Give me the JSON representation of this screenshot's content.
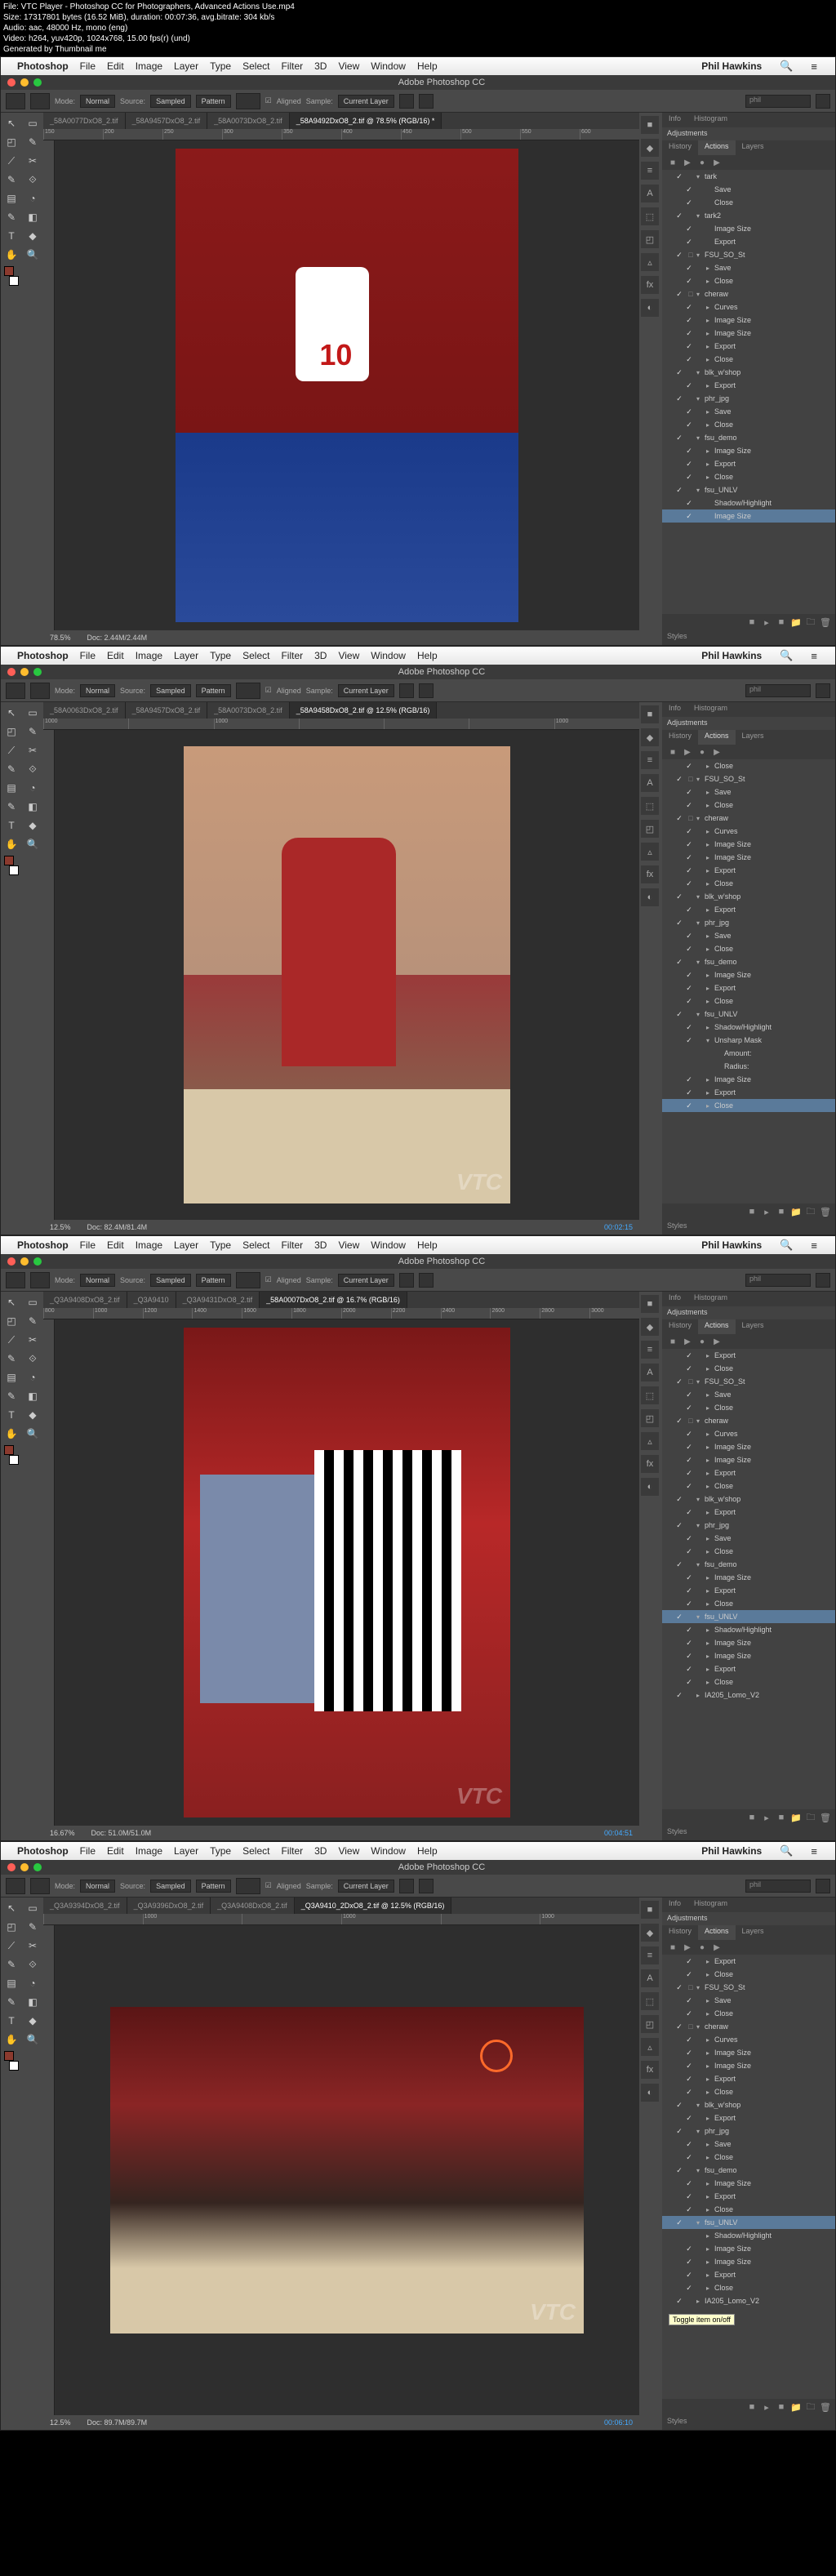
{
  "file_info": {
    "l1": "File: VTC Player - Photoshop CC for Photographers, Advanced Actions Use.mp4",
    "l2": "Size: 17317801 bytes (16.52 MiB), duration: 00:07:36, avg.bitrate: 304 kb/s",
    "l3": "Audio: aac, 48000 Hz, mono (eng)",
    "l4": "Video: h264, yuv420p, 1024x768, 15.00 fps(r) (und)",
    "l5": "Generated by Thumbnail me"
  },
  "menu": {
    "app": "Photoshop",
    "items": [
      "File",
      "Edit",
      "Image",
      "Layer",
      "Type",
      "Select",
      "Filter",
      "3D",
      "View",
      "Window",
      "Help"
    ],
    "user": "Phil Hawkins"
  },
  "title": "Adobe Photoshop CC",
  "options": {
    "mode": "Mode:",
    "mode_v": "Normal",
    "source": "Source:",
    "sampled": "Sampled",
    "pattern": "Pattern",
    "aligned": "Aligned",
    "sample": "Sample:",
    "sample_v": "Current Layer",
    "search": "phil"
  },
  "tools": [
    "↖",
    "▭",
    "◰",
    "✎",
    "⟋",
    "✂",
    "✎",
    "⟐",
    "▤",
    "◔",
    "✎",
    "◧",
    "T",
    "◆",
    "✋",
    "🔍"
  ],
  "panel_icons": [
    "■",
    "◆",
    "≡",
    "A",
    "⬚",
    "◰",
    "▵",
    "fx",
    "◐"
  ],
  "panel_tabs": {
    "info": "Info",
    "histogram": "Histogram",
    "adjustments": "Adjustments",
    "history": "History",
    "actions": "Actions",
    "layers": "Layers",
    "styles": "Styles"
  },
  "action_ctrl": [
    "■",
    "▶",
    "●",
    "▶"
  ],
  "footer_icons": [
    "■",
    "▸",
    "■",
    "📁",
    "🗀",
    "🗑"
  ],
  "windows": [
    {
      "tabs": [
        "_58A0077DxO8_2.tif",
        "_58A9457DxO8_2.tif",
        "_58A0073DxO8_2.tif"
      ],
      "active_tab": "_58A9492DxO8_2.tif @ 78.5% (RGB/16) *",
      "ruler": [
        "150",
        "200",
        "250",
        "300",
        "350",
        "400",
        "450",
        "500",
        "550",
        "600"
      ],
      "zoom": "78.5%",
      "doc": "Doc: 2.44M/2.44M",
      "time": "",
      "photo": "p1",
      "jersey_num": "10",
      "actions": [
        {
          "d": 1,
          "a": "▾",
          "t": "tark",
          "chk": "✓",
          "dlg": ""
        },
        {
          "d": 2,
          "a": "",
          "t": "Save",
          "chk": "✓",
          "dlg": ""
        },
        {
          "d": 2,
          "a": "",
          "t": "Close",
          "chk": "✓",
          "dlg": ""
        },
        {
          "d": 1,
          "a": "▾",
          "t": "tark2",
          "chk": "✓",
          "dlg": ""
        },
        {
          "d": 2,
          "a": "",
          "t": "Image Size",
          "chk": "✓",
          "dlg": ""
        },
        {
          "d": 2,
          "a": "",
          "t": "Export",
          "chk": "✓",
          "dlg": ""
        },
        {
          "d": 1,
          "a": "▾",
          "t": "FSU_SO_St",
          "chk": "✓",
          "dlg": "□"
        },
        {
          "d": 2,
          "a": "▸",
          "t": "Save",
          "chk": "✓",
          "dlg": ""
        },
        {
          "d": 2,
          "a": "▸",
          "t": "Close",
          "chk": "✓",
          "dlg": ""
        },
        {
          "d": 1,
          "a": "▾",
          "t": "cheraw",
          "chk": "✓",
          "dlg": "□"
        },
        {
          "d": 2,
          "a": "▸",
          "t": "Curves",
          "chk": "✓",
          "dlg": ""
        },
        {
          "d": 2,
          "a": "▸",
          "t": "Image Size",
          "chk": "✓",
          "dlg": ""
        },
        {
          "d": 2,
          "a": "▸",
          "t": "Image Size",
          "chk": "✓",
          "dlg": ""
        },
        {
          "d": 2,
          "a": "▸",
          "t": "Export",
          "chk": "✓",
          "dlg": ""
        },
        {
          "d": 2,
          "a": "▸",
          "t": "Close",
          "chk": "✓",
          "dlg": ""
        },
        {
          "d": 1,
          "a": "▾",
          "t": "blk_w'shop",
          "chk": "✓",
          "dlg": ""
        },
        {
          "d": 2,
          "a": "▸",
          "t": "Export",
          "chk": "✓",
          "dlg": ""
        },
        {
          "d": 1,
          "a": "▾",
          "t": "phr_jpg",
          "chk": "✓",
          "dlg": ""
        },
        {
          "d": 2,
          "a": "▸",
          "t": "Save",
          "chk": "✓",
          "dlg": ""
        },
        {
          "d": 2,
          "a": "▸",
          "t": "Close",
          "chk": "✓",
          "dlg": ""
        },
        {
          "d": 1,
          "a": "▾",
          "t": "fsu_demo",
          "chk": "✓",
          "dlg": ""
        },
        {
          "d": 2,
          "a": "▸",
          "t": "Image Size",
          "chk": "✓",
          "dlg": ""
        },
        {
          "d": 2,
          "a": "▸",
          "t": "Export",
          "chk": "✓",
          "dlg": ""
        },
        {
          "d": 2,
          "a": "▸",
          "t": "Close",
          "chk": "✓",
          "dlg": ""
        },
        {
          "d": 1,
          "a": "▾",
          "t": "fsu_UNLV",
          "chk": "✓",
          "dlg": ""
        },
        {
          "d": 2,
          "a": "",
          "t": "Shadow/Highlight",
          "chk": "✓",
          "dlg": ""
        },
        {
          "d": 2,
          "a": "",
          "t": "Image Size",
          "chk": "✓",
          "dlg": "",
          "sel": true
        }
      ]
    },
    {
      "tabs": [
        "_58A0063DxO8_2.tif",
        "_58A9457DxO8_2.tif",
        "_58A0073DxO8_2.tif"
      ],
      "active_tab": "_58A9458DxO8_2.tif @ 12.5% (RGB/16)",
      "ruler": [
        "1000",
        "",
        "1000",
        "",
        "",
        "",
        "1000"
      ],
      "zoom": "12.5%",
      "doc": "Doc: 82.4M/81.4M",
      "time": "00:02:15",
      "photo": "p2",
      "actions": [
        {
          "d": 2,
          "a": "▸",
          "t": "Close",
          "chk": "✓",
          "dlg": ""
        },
        {
          "d": 1,
          "a": "▾",
          "t": "FSU_SO_St",
          "chk": "✓",
          "dlg": "□"
        },
        {
          "d": 2,
          "a": "▸",
          "t": "Save",
          "chk": "✓",
          "dlg": ""
        },
        {
          "d": 2,
          "a": "▸",
          "t": "Close",
          "chk": "✓",
          "dlg": ""
        },
        {
          "d": 1,
          "a": "▾",
          "t": "cheraw",
          "chk": "✓",
          "dlg": "□"
        },
        {
          "d": 2,
          "a": "▸",
          "t": "Curves",
          "chk": "✓",
          "dlg": ""
        },
        {
          "d": 2,
          "a": "▸",
          "t": "Image Size",
          "chk": "✓",
          "dlg": ""
        },
        {
          "d": 2,
          "a": "▸",
          "t": "Image Size",
          "chk": "✓",
          "dlg": ""
        },
        {
          "d": 2,
          "a": "▸",
          "t": "Export",
          "chk": "✓",
          "dlg": ""
        },
        {
          "d": 2,
          "a": "▸",
          "t": "Close",
          "chk": "✓",
          "dlg": ""
        },
        {
          "d": 1,
          "a": "▾",
          "t": "blk_w'shop",
          "chk": "✓",
          "dlg": ""
        },
        {
          "d": 2,
          "a": "▸",
          "t": "Export",
          "chk": "✓",
          "dlg": ""
        },
        {
          "d": 1,
          "a": "▾",
          "t": "phr_jpg",
          "chk": "✓",
          "dlg": ""
        },
        {
          "d": 2,
          "a": "▸",
          "t": "Save",
          "chk": "✓",
          "dlg": ""
        },
        {
          "d": 2,
          "a": "▸",
          "t": "Close",
          "chk": "✓",
          "dlg": ""
        },
        {
          "d": 1,
          "a": "▾",
          "t": "fsu_demo",
          "chk": "✓",
          "dlg": ""
        },
        {
          "d": 2,
          "a": "▸",
          "t": "Image Size",
          "chk": "✓",
          "dlg": ""
        },
        {
          "d": 2,
          "a": "▸",
          "t": "Export",
          "chk": "✓",
          "dlg": ""
        },
        {
          "d": 2,
          "a": "▸",
          "t": "Close",
          "chk": "✓",
          "dlg": ""
        },
        {
          "d": 1,
          "a": "▾",
          "t": "fsu_UNLV",
          "chk": "✓",
          "dlg": ""
        },
        {
          "d": 2,
          "a": "▸",
          "t": "Shadow/Highlight",
          "chk": "✓",
          "dlg": ""
        },
        {
          "d": 2,
          "a": "▾",
          "t": "Unsharp Mask",
          "chk": "✓",
          "dlg": ""
        },
        {
          "d": 3,
          "a": "",
          "t": "Amount: ",
          "chk": "",
          "dlg": ""
        },
        {
          "d": 3,
          "a": "",
          "t": "Radius: ",
          "chk": "",
          "dlg": ""
        },
        {
          "d": 2,
          "a": "▸",
          "t": "Image Size",
          "chk": "✓",
          "dlg": ""
        },
        {
          "d": 2,
          "a": "▸",
          "t": "Export",
          "chk": "✓",
          "dlg": ""
        },
        {
          "d": 2,
          "a": "▸",
          "t": "Close",
          "chk": "✓",
          "dlg": "",
          "sel": true
        }
      ]
    },
    {
      "tabs": [
        "_Q3A9408DxO8_2.tif",
        "_Q3A9410",
        "_Q3A9431DxO8_2.tif"
      ],
      "active_tab": "_58A0007DxO8_2.tif @ 16.7% (RGB/16)",
      "ruler": [
        "800",
        "1000",
        "1200",
        "1400",
        "1600",
        "1800",
        "2000",
        "2200",
        "2400",
        "2600",
        "2800",
        "3000"
      ],
      "zoom": "16.67%",
      "doc": "Doc: 51.0M/51.0M",
      "time": "00:04:51",
      "photo": "p3",
      "actions": [
        {
          "d": 2,
          "a": "▸",
          "t": "Export",
          "chk": "✓",
          "dlg": ""
        },
        {
          "d": 2,
          "a": "▸",
          "t": "Close",
          "chk": "✓",
          "dlg": ""
        },
        {
          "d": 1,
          "a": "▾",
          "t": "FSU_SO_St",
          "chk": "✓",
          "dlg": "□"
        },
        {
          "d": 2,
          "a": "▸",
          "t": "Save",
          "chk": "✓",
          "dlg": ""
        },
        {
          "d": 2,
          "a": "▸",
          "t": "Close",
          "chk": "✓",
          "dlg": ""
        },
        {
          "d": 1,
          "a": "▾",
          "t": "cheraw",
          "chk": "✓",
          "dlg": "□"
        },
        {
          "d": 2,
          "a": "▸",
          "t": "Curves",
          "chk": "✓",
          "dlg": ""
        },
        {
          "d": 2,
          "a": "▸",
          "t": "Image Size",
          "chk": "✓",
          "dlg": ""
        },
        {
          "d": 2,
          "a": "▸",
          "t": "Image Size",
          "chk": "✓",
          "dlg": ""
        },
        {
          "d": 2,
          "a": "▸",
          "t": "Export",
          "chk": "✓",
          "dlg": ""
        },
        {
          "d": 2,
          "a": "▸",
          "t": "Close",
          "chk": "✓",
          "dlg": ""
        },
        {
          "d": 1,
          "a": "▾",
          "t": "blk_w'shop",
          "chk": "✓",
          "dlg": ""
        },
        {
          "d": 2,
          "a": "▸",
          "t": "Export",
          "chk": "✓",
          "dlg": ""
        },
        {
          "d": 1,
          "a": "▾",
          "t": "phr_jpg",
          "chk": "✓",
          "dlg": ""
        },
        {
          "d": 2,
          "a": "▸",
          "t": "Save",
          "chk": "✓",
          "dlg": ""
        },
        {
          "d": 2,
          "a": "▸",
          "t": "Close",
          "chk": "✓",
          "dlg": ""
        },
        {
          "d": 1,
          "a": "▾",
          "t": "fsu_demo",
          "chk": "✓",
          "dlg": ""
        },
        {
          "d": 2,
          "a": "▸",
          "t": "Image Size",
          "chk": "✓",
          "dlg": ""
        },
        {
          "d": 2,
          "a": "▸",
          "t": "Export",
          "chk": "✓",
          "dlg": ""
        },
        {
          "d": 2,
          "a": "▸",
          "t": "Close",
          "chk": "✓",
          "dlg": ""
        },
        {
          "d": 1,
          "a": "▾",
          "t": "fsu_UNLV",
          "chk": "✓",
          "dlg": "",
          "sel": true
        },
        {
          "d": 2,
          "a": "▸",
          "t": "Shadow/Highlight",
          "chk": "✓",
          "dlg": ""
        },
        {
          "d": 2,
          "a": "▸",
          "t": "Image Size",
          "chk": "✓",
          "dlg": ""
        },
        {
          "d": 2,
          "a": "▸",
          "t": "Image Size",
          "chk": "✓",
          "dlg": ""
        },
        {
          "d": 2,
          "a": "▸",
          "t": "Export",
          "chk": "✓",
          "dlg": ""
        },
        {
          "d": 2,
          "a": "▸",
          "t": "Close",
          "chk": "✓",
          "dlg": ""
        },
        {
          "d": 1,
          "a": "▸",
          "t": "IA205_Lomo_V2",
          "chk": "✓",
          "dlg": ""
        }
      ]
    },
    {
      "tabs": [
        "_Q3A9394DxO8_2.tif",
        "_Q3A9396DxO8_2.tif",
        "_Q3A9408DxO8_2.tif"
      ],
      "active_tab": "_Q3A9410_2DxO8_2.tif @ 12.5% (RGB/16)",
      "ruler": [
        "",
        "1000",
        "",
        "1000",
        "",
        "1000"
      ],
      "zoom": "12.5%",
      "doc": "Doc: 89.7M/89.7M",
      "time": "00:06:10",
      "photo": "p4",
      "tooltip": "Toggle item on/off",
      "actions": [
        {
          "d": 2,
          "a": "▸",
          "t": "Export",
          "chk": "✓",
          "dlg": ""
        },
        {
          "d": 2,
          "a": "▸",
          "t": "Close",
          "chk": "✓",
          "dlg": ""
        },
        {
          "d": 1,
          "a": "▾",
          "t": "FSU_SO_St",
          "chk": "✓",
          "dlg": "□"
        },
        {
          "d": 2,
          "a": "▸",
          "t": "Save",
          "chk": "✓",
          "dlg": ""
        },
        {
          "d": 2,
          "a": "▸",
          "t": "Close",
          "chk": "✓",
          "dlg": ""
        },
        {
          "d": 1,
          "a": "▾",
          "t": "cheraw",
          "chk": "✓",
          "dlg": "□"
        },
        {
          "d": 2,
          "a": "▸",
          "t": "Curves",
          "chk": "✓",
          "dlg": ""
        },
        {
          "d": 2,
          "a": "▸",
          "t": "Image Size",
          "chk": "✓",
          "dlg": ""
        },
        {
          "d": 2,
          "a": "▸",
          "t": "Image Size",
          "chk": "✓",
          "dlg": ""
        },
        {
          "d": 2,
          "a": "▸",
          "t": "Export",
          "chk": "✓",
          "dlg": ""
        },
        {
          "d": 2,
          "a": "▸",
          "t": "Close",
          "chk": "✓",
          "dlg": ""
        },
        {
          "d": 1,
          "a": "▾",
          "t": "blk_w'shop",
          "chk": "✓",
          "dlg": ""
        },
        {
          "d": 2,
          "a": "▸",
          "t": "Export",
          "chk": "✓",
          "dlg": ""
        },
        {
          "d": 1,
          "a": "▾",
          "t": "phr_jpg",
          "chk": "✓",
          "dlg": ""
        },
        {
          "d": 2,
          "a": "▸",
          "t": "Save",
          "chk": "✓",
          "dlg": ""
        },
        {
          "d": 2,
          "a": "▸",
          "t": "Close",
          "chk": "✓",
          "dlg": ""
        },
        {
          "d": 1,
          "a": "▾",
          "t": "fsu_demo",
          "chk": "✓",
          "dlg": ""
        },
        {
          "d": 2,
          "a": "▸",
          "t": "Image Size",
          "chk": "✓",
          "dlg": ""
        },
        {
          "d": 2,
          "a": "▸",
          "t": "Export",
          "chk": "✓",
          "dlg": ""
        },
        {
          "d": 2,
          "a": "▸",
          "t": "Close",
          "chk": "✓",
          "dlg": ""
        },
        {
          "d": 1,
          "a": "▾",
          "t": "fsu_UNLV",
          "chk": "✓",
          "dlg": "",
          "sel": true
        },
        {
          "d": 2,
          "a": "▸",
          "t": "Shadow/Highlight",
          "chk": "",
          "dlg": ""
        },
        {
          "d": 2,
          "a": "▸",
          "t": "Image Size",
          "chk": "✓",
          "dlg": ""
        },
        {
          "d": 2,
          "a": "▸",
          "t": "Image Size",
          "chk": "✓",
          "dlg": ""
        },
        {
          "d": 2,
          "a": "▸",
          "t": "Export",
          "chk": "✓",
          "dlg": ""
        },
        {
          "d": 2,
          "a": "▸",
          "t": "Close",
          "chk": "✓",
          "dlg": ""
        },
        {
          "d": 1,
          "a": "▸",
          "t": "IA205_Lomo_V2",
          "chk": "✓",
          "dlg": ""
        }
      ]
    }
  ]
}
